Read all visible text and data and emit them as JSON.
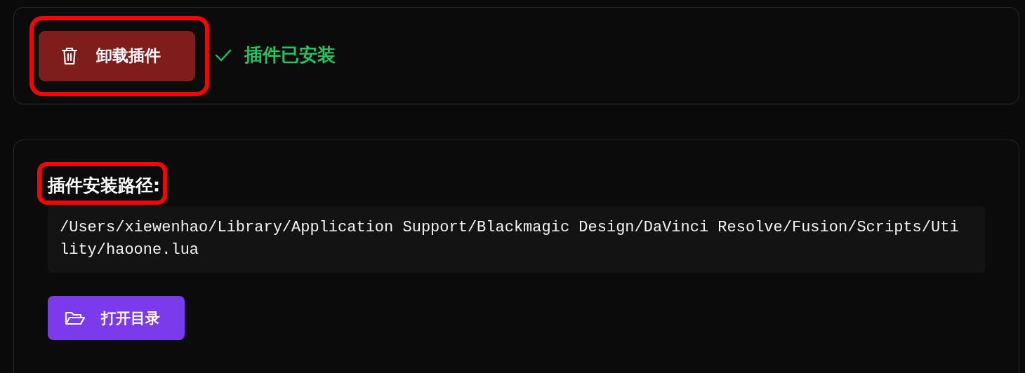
{
  "install_panel": {
    "uninstall_button": {
      "label": "卸载插件",
      "highlighted": true
    },
    "status": {
      "text": "插件已安装",
      "installed": true
    }
  },
  "path_panel": {
    "label": {
      "text": "插件安装路径:",
      "highlighted": true
    },
    "path": "/Users/xiewenhao/Library/Application Support/Blackmagic Design/DaVinci Resolve/Fusion/Scripts/Utility/haoone.lua",
    "open_button": {
      "label": "打开目录"
    }
  }
}
